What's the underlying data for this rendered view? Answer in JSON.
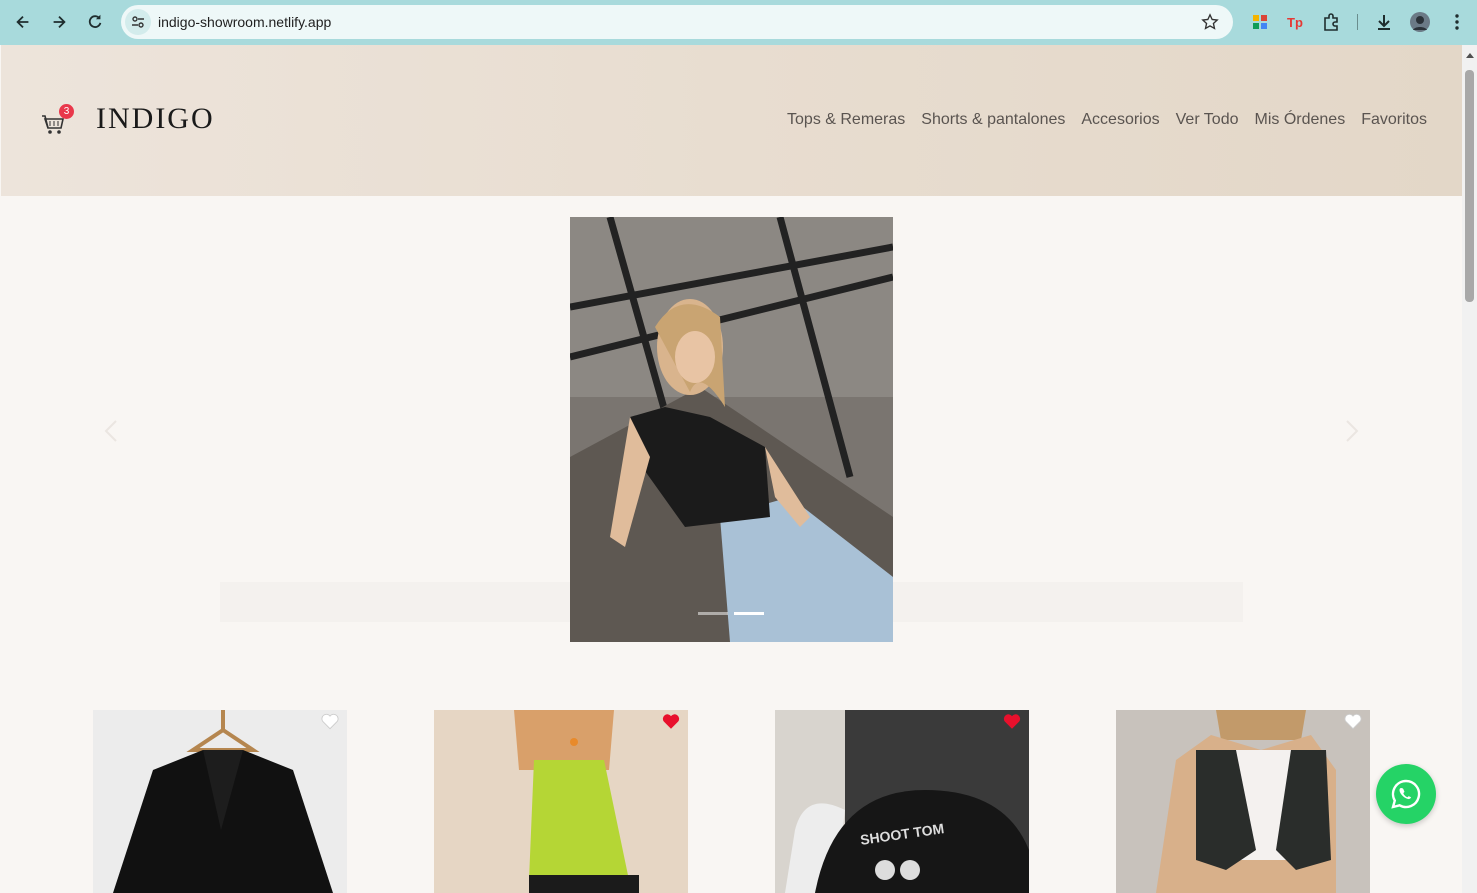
{
  "browser": {
    "url": "indigo-showroom.netlify.app"
  },
  "site": {
    "brand": "INDIGO",
    "cart_count": "3",
    "nav": [
      {
        "label": "Tops & Remeras"
      },
      {
        "label": "Shorts & pantalones"
      },
      {
        "label": "Accesorios"
      },
      {
        "label": "Ver Todo"
      },
      {
        "label": "Mis Órdenes"
      },
      {
        "label": "Favoritos"
      }
    ]
  },
  "carousel": {
    "slide_count": 2,
    "active_index": 1
  },
  "products": [
    {
      "name": "black-blazer",
      "favorited": false
    },
    {
      "name": "lime-tube-top",
      "favorited": true
    },
    {
      "name": "black-graphic-hoodie",
      "favorited": true
    },
    {
      "name": "black-vest",
      "favorited": false
    }
  ],
  "colors": {
    "chrome": "#a8dadc",
    "header_bg": "#e8ddd0",
    "badge": "#e9384b",
    "favorite_active": "#e8102c",
    "whatsapp": "#25d366"
  }
}
